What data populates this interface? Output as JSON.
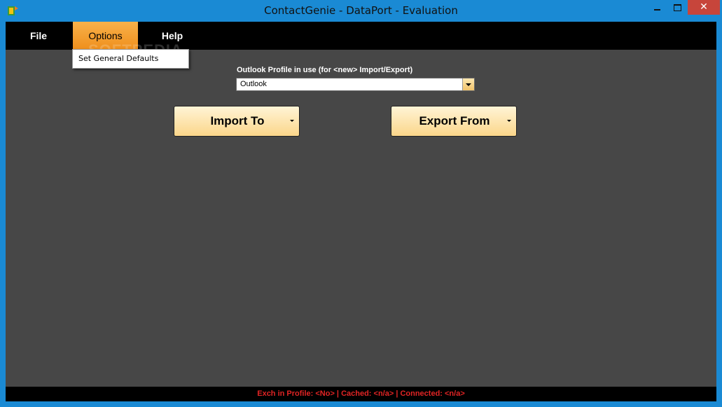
{
  "window": {
    "title": "ContactGenie - DataPort - Evaluation",
    "close_glyph": "✕",
    "app_icon": "contactgenie-app-icon"
  },
  "menubar": {
    "items": [
      {
        "label": "File"
      },
      {
        "label": "Options",
        "active": true
      },
      {
        "label": "Help"
      }
    ]
  },
  "watermark": {
    "text": "SOFTPEDIA"
  },
  "options_menu": {
    "items": [
      {
        "label": "Set General Defaults"
      }
    ]
  },
  "profile": {
    "label": "Outlook Profile in use (for <new> Import/Export)",
    "selected": "Outlook"
  },
  "actions": {
    "import_label": "Import To",
    "export_label": "Export From"
  },
  "status": {
    "text": "Exch in Profile: <No>  | Cached: <n/a> | Connected: <n/a>"
  },
  "colors": {
    "titlebar": "#1a8ad4",
    "client_bg": "#474747",
    "menubar_bg": "#000000",
    "active_menu": "#f5a53a",
    "button_gradient_top": "#fff4d6",
    "button_gradient_bottom": "#fbd68a",
    "status_text": "#e12424"
  }
}
